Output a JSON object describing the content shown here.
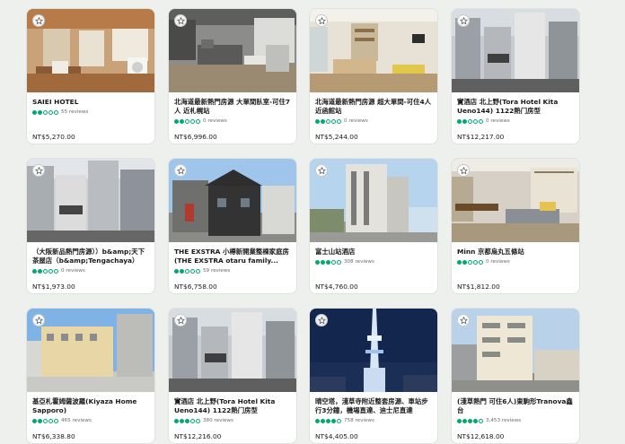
{
  "colors": {
    "accent": "#00aa6c",
    "page_bg": "#eef0ee"
  },
  "cards": [
    {
      "title": "SAIEI HOTEL",
      "rating": 2,
      "reviews": "55 reviews",
      "price": "NT$5,270.00",
      "image": "japanese-room-interior"
    },
    {
      "title": "北海道最新熱門房源 大單間臥室-可住7人 近札幌站",
      "rating": 2,
      "reviews": "0 reviews",
      "price": "NT$6,996.00",
      "image": "modern-living-room"
    },
    {
      "title": "北海道最新熱門房源 超大單間-可住4人 近函館站",
      "rating": 2,
      "reviews": "0 reviews",
      "price": "NT$5,244.00",
      "image": "bright-living-room"
    },
    {
      "title": "實酒店 北上野(Tora Hotel Kita Ueno144) 1122熱门房型",
      "rating": 2,
      "reviews": "0 reviews",
      "price": "NT$12,217.00",
      "image": "city-buildings-balcony"
    },
    {
      "title": "（大阪新品熱門房源））b&amp;天下茶屋店（b&amp;Tengachaya）",
      "rating": 2,
      "reviews": "0 reviews",
      "price": "NT$1,973.00",
      "image": "city-buildings-street"
    },
    {
      "title": "THE EXSTRA 小樽新開業整棟家庭房(THE EXSTRA otaru family...",
      "rating": 2,
      "reviews": "59 reviews",
      "price": "NT$6,758.00",
      "image": "dark-house-exterior"
    },
    {
      "title": "富士山站酒店",
      "rating": 3,
      "reviews": "308 reviews",
      "price": "NT$4,760.00",
      "image": "hotel-building-exterior"
    },
    {
      "title": "Minn 京都烏丸五條站",
      "rating": 2,
      "reviews": "0 reviews",
      "price": "NT$1,812.00",
      "image": "japanese-dining-room"
    },
    {
      "title": "基亞札霍姆薩波羅(Kiyaza Home Sapporo)",
      "rating": 2,
      "reviews": "465 reviews",
      "price": "NT$6,338.80",
      "image": "apartment-exterior"
    },
    {
      "title": "實酒店 北上野(Tora Hotel Kita Ueno144) 1122熱门房型",
      "rating": 3,
      "reviews": "380 reviews",
      "price": "NT$12,216.00",
      "image": "city-buildings-balcony"
    },
    {
      "title": "晴空塔，淺草寺附近整套房源、車站步行3分鐘，機場直達、迪士尼直達",
      "rating": 4,
      "reviews": "758 reviews",
      "price": "NT$4,405.00",
      "image": "skytree-night"
    },
    {
      "title": "(淺草熱門 可住6人)東駒形Tranova鑫台",
      "rating": 4,
      "reviews": "3,453 reviews",
      "price": "NT$12,618.00",
      "image": "apartment-building-street"
    }
  ]
}
